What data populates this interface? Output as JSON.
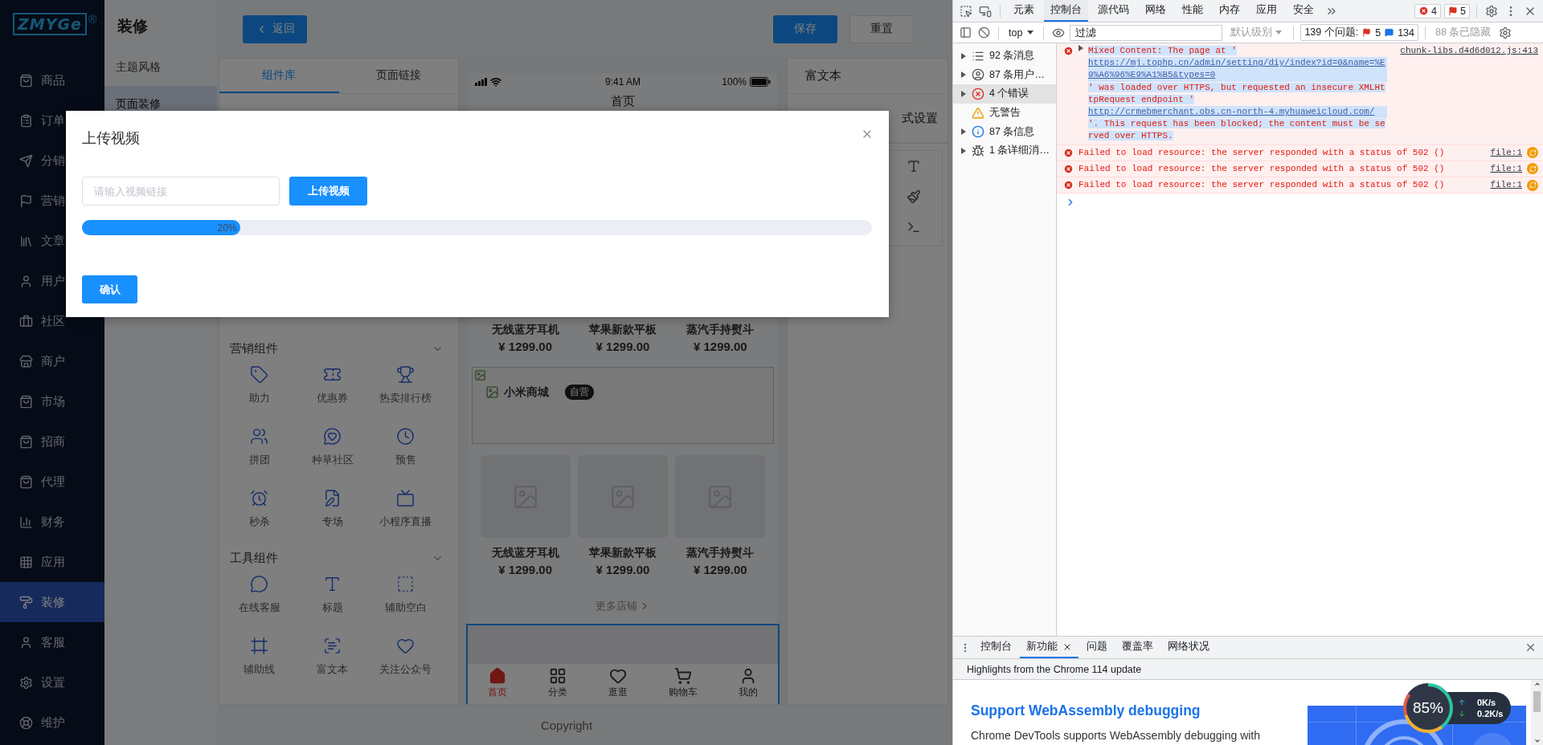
{
  "sidebar": {
    "logo": "ZMYGe",
    "registered": "®",
    "items": [
      {
        "label": "商品",
        "selected": false
      },
      {
        "label": "订单",
        "selected": false
      },
      {
        "label": "分销",
        "selected": false
      },
      {
        "label": "营销",
        "selected": false
      },
      {
        "label": "文章",
        "selected": false
      },
      {
        "label": "用户",
        "selected": false
      },
      {
        "label": "社区",
        "selected": false
      },
      {
        "label": "商户",
        "selected": false
      },
      {
        "label": "市场",
        "selected": false
      },
      {
        "label": "招商",
        "selected": false
      },
      {
        "label": "代理",
        "selected": false
      },
      {
        "label": "财务",
        "selected": false
      },
      {
        "label": "应用",
        "selected": false
      },
      {
        "label": "装修",
        "selected": true
      },
      {
        "label": "客服",
        "selected": false
      },
      {
        "label": "设置",
        "selected": false
      },
      {
        "label": "维护",
        "selected": false
      }
    ]
  },
  "subnav": {
    "title": "装修",
    "items": [
      {
        "label": "主题风格",
        "selected": false
      },
      {
        "label": "页面装修",
        "selected": true
      }
    ]
  },
  "header": {
    "back": "返回",
    "save": "保存",
    "reset": "重置"
  },
  "components": {
    "tabs": [
      {
        "label": "组件库",
        "selected": true
      },
      {
        "label": "页面链接",
        "selected": false
      }
    ],
    "groups": [
      {
        "title": "营销组件",
        "expanded": true,
        "items": [
          "助力",
          "优惠券",
          "热卖排行榜",
          "拼团",
          "种草社区",
          "预售",
          "秒杀",
          "专场",
          "小程序直播"
        ]
      },
      {
        "title": "工具组件",
        "expanded": true,
        "items": [
          "在线客服",
          "标题",
          "辅助空白",
          "辅助线",
          "富文本",
          "关注公众号"
        ]
      }
    ]
  },
  "phone": {
    "time": "9:41 AM",
    "battery": "100%",
    "title": "首页",
    "product_row": [
      {
        "name": "无线蓝牙耳机",
        "price": "¥ 1299.00"
      },
      {
        "name": "苹果新款平板",
        "price": "¥ 1299.00"
      },
      {
        "name": "蒸汽手持熨斗",
        "price": "¥ 1299.00"
      }
    ],
    "store": {
      "name": "小米商城",
      "badge": "自营"
    },
    "product_cards": [
      {
        "name": "无线蓝牙耳机",
        "price": "¥ 1299.00"
      },
      {
        "name": "苹果新款平板",
        "price": "¥ 1299.00"
      },
      {
        "name": "蒸汽手持熨斗",
        "price": "¥ 1299.00"
      }
    ],
    "more": "更多店铺",
    "tabbar": [
      {
        "label": "首页",
        "selected": true
      },
      {
        "label": "分类",
        "selected": false
      },
      {
        "label": "逛逛",
        "selected": false
      },
      {
        "label": "购物车",
        "selected": false
      },
      {
        "label": "我的",
        "selected": false
      }
    ]
  },
  "right_panel": {
    "title": "富文本",
    "tab": "式设置"
  },
  "footer": "Copyright",
  "dialog": {
    "title": "上传视频",
    "input": {
      "placeholder": "请输入视频链接"
    },
    "upload": "上传视频",
    "progress": {
      "level": 0.2,
      "label": "20%"
    },
    "confirm": "确认"
  },
  "devtools": {
    "tabs": [
      {
        "label": "元素",
        "selected": false
      },
      {
        "label": "控制台",
        "selected": true
      },
      {
        "label": "源代码",
        "selected": false
      },
      {
        "label": "网络",
        "selected": false
      },
      {
        "label": "性能",
        "selected": false
      },
      {
        "label": "内存",
        "selected": false
      },
      {
        "label": "应用",
        "selected": false
      },
      {
        "label": "安全",
        "selected": false
      }
    ],
    "error_count": "4",
    "issue_count": "5",
    "toolbar": {
      "context": "top",
      "filter_placeholder": "过滤",
      "level": "默认级别",
      "issues_label": "139 个问题:",
      "issue_errors": "5",
      "issue_info": "134",
      "hidden": "88 条已隐藏"
    },
    "sidebar": [
      {
        "label": "92 条消息",
        "expandable": true,
        "selected": false
      },
      {
        "label": "87 条用户…",
        "expandable": true,
        "selected": false
      },
      {
        "label": "4 个错误",
        "expandable": true,
        "selected": true
      },
      {
        "label": "无警告",
        "expandable": false,
        "selected": false
      },
      {
        "label": "87 条信息",
        "expandable": true,
        "selected": false
      },
      {
        "label": "1 条详细消…",
        "expandable": true,
        "selected": false
      }
    ],
    "messages": [
      {
        "expandable": true,
        "highlighted": true,
        "source": "chunk-libs.d4d6d012.js:413",
        "segments": [
          {
            "text": "Mixed Content: The page at '",
            "link": false
          },
          {
            "text": "https://mj.tophp.cn/admin/setting/diy/index?id=0&name=%E9%A6%96%E9%A1%B5&types=0",
            "link": true
          },
          {
            "text": "' was loaded over HTTPS, but requested an insecure XMLHttpRequest endpoint '",
            "link": false
          },
          {
            "text": "http://crmebmerchant.obs.cn-north-4.myhuaweicloud.com/",
            "link": true
          },
          {
            "text": "'. This request has been blocked; the content must be served over HTTPS.",
            "link": false
          }
        ]
      },
      {
        "expandable": false,
        "highlighted": false,
        "source": "file:1",
        "text": "Failed to load resource: the server responded with a status of 502 ()"
      },
      {
        "expandable": false,
        "highlighted": false,
        "source": "file:1",
        "text": "Failed to load resource: the server responded with a status of 502 ()"
      },
      {
        "expandable": false,
        "highlighted": false,
        "source": "file:1",
        "text": "Failed to load resource: the server responded with a status of 502 ()"
      }
    ],
    "drawer": {
      "tabs": [
        {
          "label": "控制台",
          "selected": false,
          "closable": false
        },
        {
          "label": "新功能",
          "selected": true,
          "closable": true
        },
        {
          "label": "问题",
          "selected": false,
          "closable": false
        },
        {
          "label": "覆盖率",
          "selected": false,
          "closable": false
        },
        {
          "label": "网络状况",
          "selected": false,
          "closable": false
        }
      ],
      "banner": "Highlights from the Chrome 114 update",
      "heading": "Support WebAssembly debugging",
      "body": "Chrome DevTools supports WebAssembly debugging with"
    }
  },
  "monitor": {
    "percent": "85%",
    "up": "0K/s",
    "down": "0.2K/s"
  }
}
